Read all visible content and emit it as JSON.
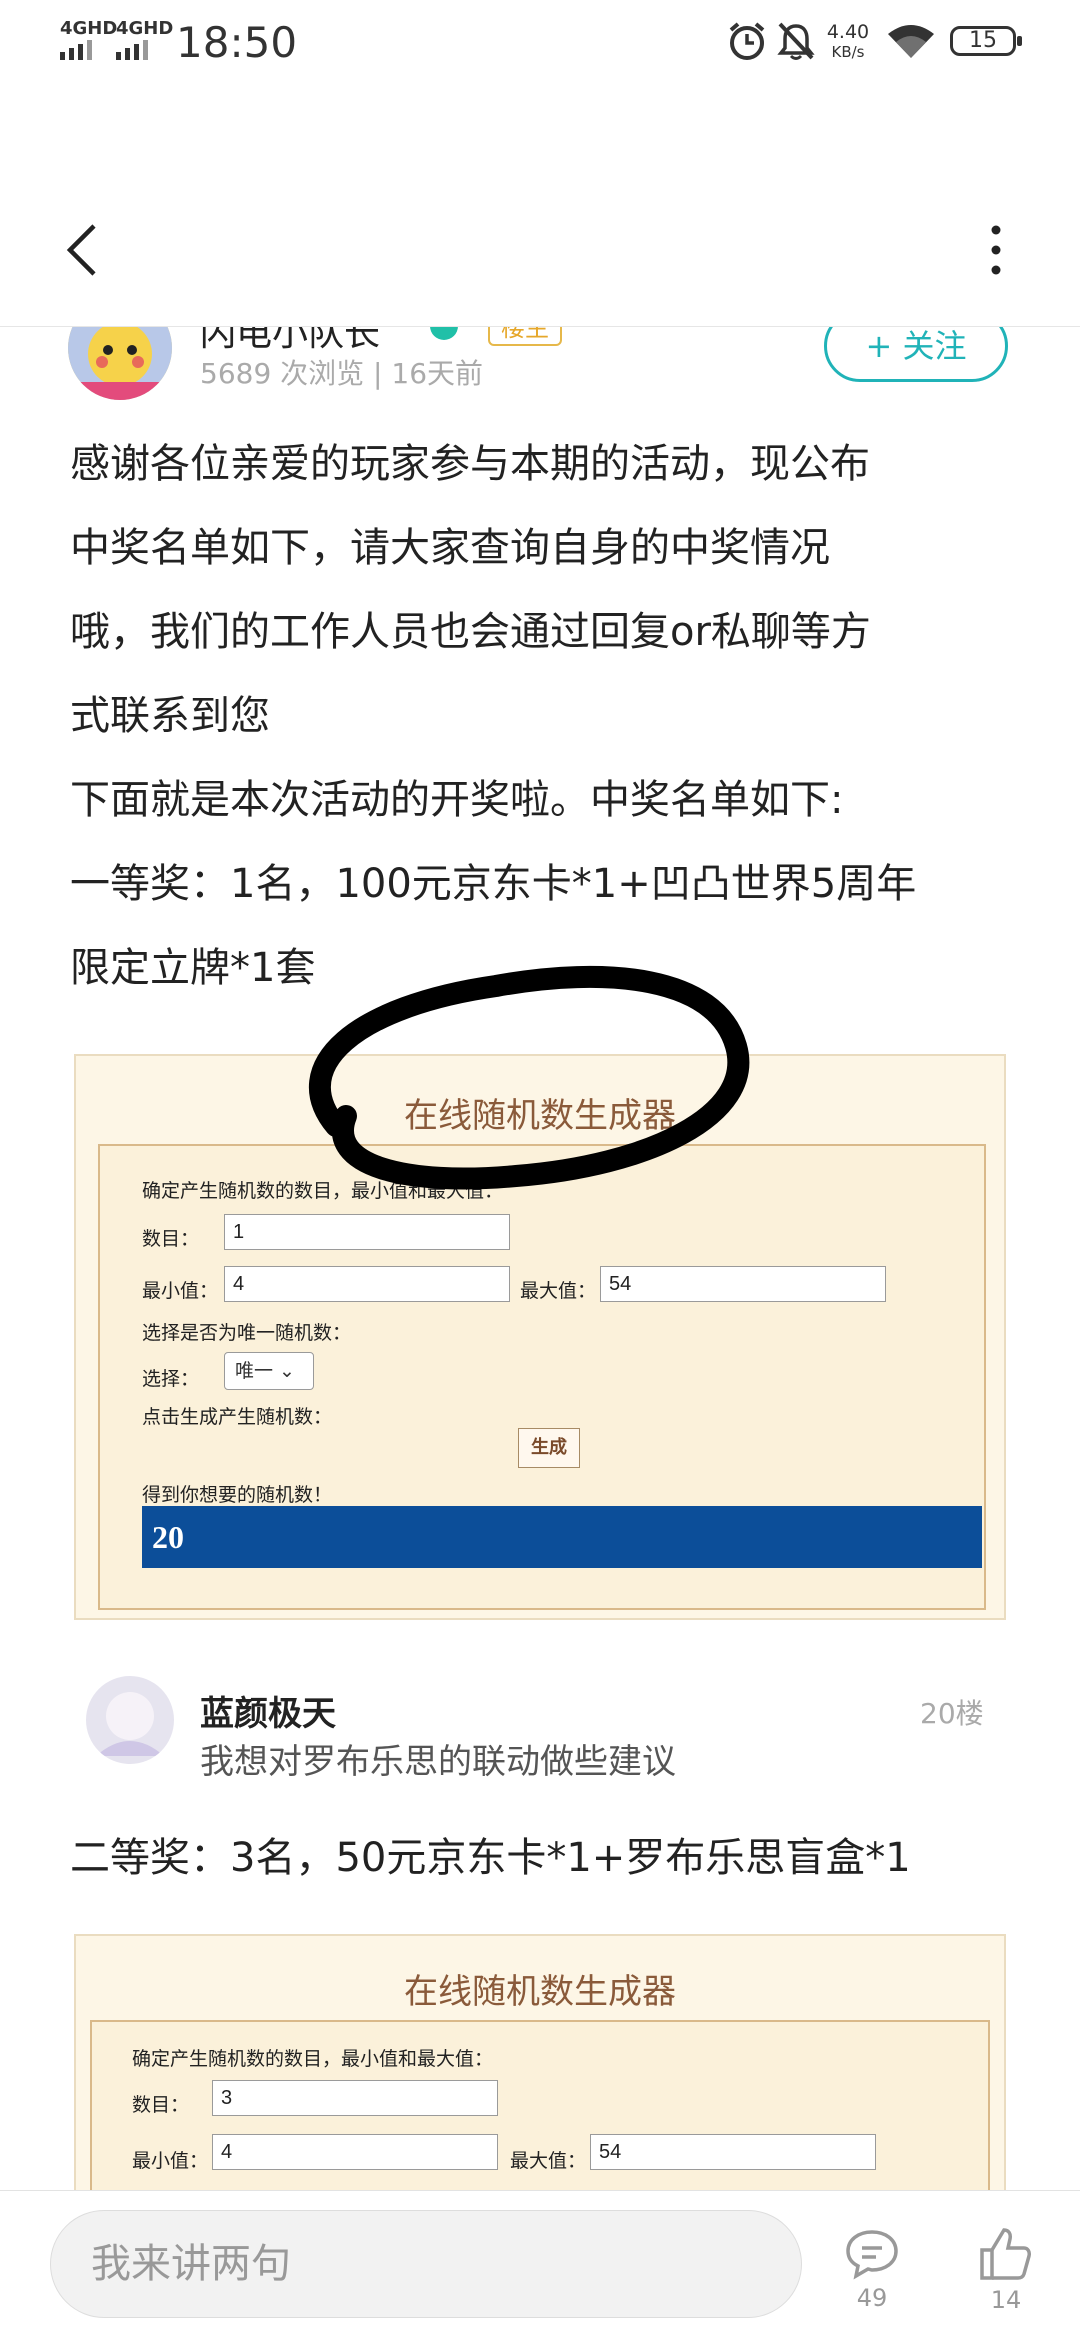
{
  "status_bar": {
    "signal1": "4GHD",
    "signal2": "4GHD",
    "time": "18:50",
    "net_speed": "4.40",
    "net_unit": "KB/s",
    "battery": "15"
  },
  "author": {
    "name": "闪电小队长",
    "badge": "楼主",
    "views": "5689 次浏览 | 16天前",
    "follow_label": "+ 关注"
  },
  "post": {
    "paragraphs": [
      "感谢各位亲爱的玩家参与本期的活动，现公布",
      "中奖名单如下，请大家查询自身的中奖情况",
      "哦，我们的工作人员也会通过回复or私聊等方",
      "式联系到您",
      "下面就是本次活动的开奖啦。中奖名单如下:",
      "一等奖：1名，100元京东卡*1+凹凸世界5周年",
      "限定立牌*1套"
    ],
    "second_prize": "二等奖：3名，50元京东卡*1+罗布乐思盲盒*1"
  },
  "generator1": {
    "title": "在线随机数生成器",
    "instruction": "确定产生随机数的数目，最小值和最大值：",
    "count_label": "数目：",
    "count_value": "1",
    "min_label": "最小值：",
    "min_value": "4",
    "max_label": "最大值：",
    "max_value": "54",
    "unique_question": "选择是否为唯一随机数：",
    "select_label": "选择：",
    "select_value": "唯一",
    "click_text": "点击生成产生随机数：",
    "button_label": "生成",
    "result_label": "得到你想要的随机数！",
    "result_value": "20"
  },
  "comment": {
    "name": "蓝颜极天",
    "text": "我想对罗布乐思的联动做些建议",
    "floor": "20楼"
  },
  "generator2": {
    "title": "在线随机数生成器",
    "instruction": "确定产生随机数的数目，最小值和最大值：",
    "count_label": "数目：",
    "count_value": "3",
    "min_label": "最小值：",
    "min_value": "4",
    "max_label": "最大值：",
    "max_value": "54"
  },
  "bottom_bar": {
    "input_placeholder": "我来讲两句",
    "comment_count": "49",
    "like_count": "14"
  }
}
